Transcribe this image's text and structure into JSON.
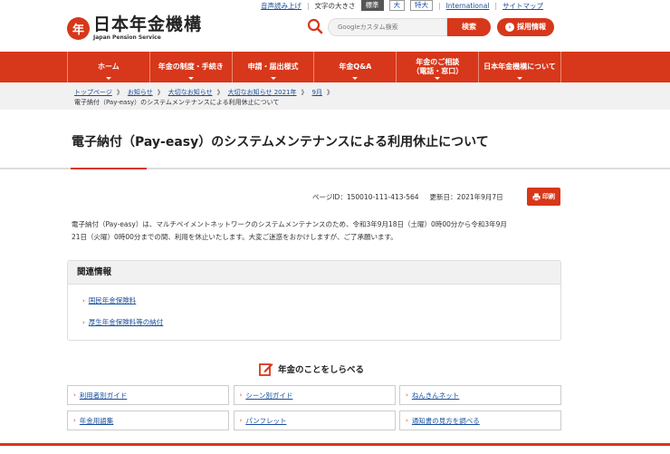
{
  "utility": {
    "read_aloud": "音声読み上げ",
    "font_size_label": "文字の大きさ",
    "size_standard": "標準",
    "size_large": "大",
    "size_xlarge": "特大",
    "international": "International",
    "sitemap": "サイトマップ"
  },
  "header": {
    "logo_mark": "年",
    "logo_main": "日本年金機構",
    "logo_sub": "Japan Pension Service",
    "search_placeholder": "Googleカスタム検索",
    "search_button": "検索",
    "recruit_button": "採用情報"
  },
  "nav": {
    "items": [
      {
        "line1": "ホーム",
        "line2": ""
      },
      {
        "line1": "年金の制度・手続き",
        "line2": ""
      },
      {
        "line1": "申請・届出様式",
        "line2": ""
      },
      {
        "line1": "年金Q&A",
        "line2": ""
      },
      {
        "line1": "年金のご相談",
        "line2": "（電話・窓口）"
      },
      {
        "line1": "日本年金機構について",
        "line2": ""
      }
    ]
  },
  "breadcrumb": {
    "items": [
      "トップページ",
      "お知らせ",
      "大切なお知らせ",
      "大切なお知らせ 2021年",
      "9月"
    ],
    "separator": "》",
    "current": "電子納付（Pay-easy）のシステムメンテナンスによる利用休止について"
  },
  "page": {
    "title": "電子納付（Pay-easy）のシステムメンテナンスによる利用休止について",
    "page_id": "ページID：150010-111-413-564",
    "updated": "更新日：2021年9月7日",
    "print_label": "印刷",
    "body_line1": "電子納付（Pay-easy）は、マルチペイメントネットワークのシステムメンテナンスのため、令和3年9月18日（土曜）0時00分から令和3年9月",
    "body_line2": "21日（火曜）0時00分までの間、利用を休止いたします。大変ご迷惑をおかけしますが、ご了承願います。"
  },
  "related": {
    "heading": "関連情報",
    "links": [
      "国民年金保険料",
      "厚生年金保険料等の納付"
    ]
  },
  "lookup": {
    "heading": "年金のことをしらべる",
    "links": [
      "利用者別ガイド",
      "シーン別ガイド",
      "ねんきんネット",
      "年金用語集",
      "パンフレット",
      "通知書の見方を調べる"
    ]
  },
  "colors": {
    "brand": "#d7371a",
    "link": "#1a4f9c"
  }
}
